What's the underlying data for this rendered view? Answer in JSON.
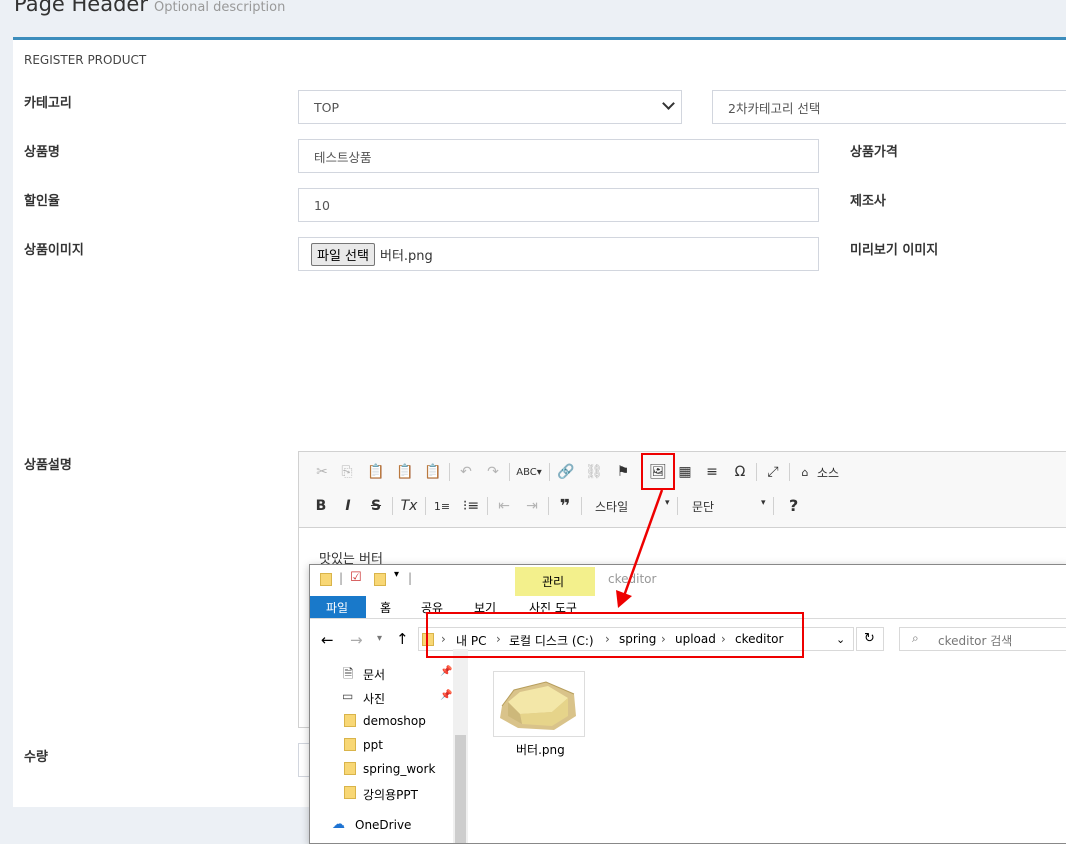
{
  "page_header": {
    "title": "Page Header",
    "description": "Optional description"
  },
  "box_title": "REGISTER PRODUCT",
  "form": {
    "category_label": "카테고리",
    "category_value": "TOP",
    "subcategory_value": "2차카테고리 선택",
    "name_label": "상품명",
    "name_value": "테스트상품",
    "price_label": "상품가격",
    "discount_label": "할인율",
    "discount_value": "10",
    "maker_label": "제조사",
    "image_label": "상품이미지",
    "file_button": "파일 선택",
    "file_name": "버터.png",
    "preview_label": "미리보기 이미지",
    "description_label": "상품설명",
    "quantity_label": "수량"
  },
  "editor": {
    "content": "맛있는 버터",
    "source_label": "소스",
    "style_label": "스타일",
    "paragraph_label": "문단",
    "help_label": "?"
  },
  "explorer": {
    "title": "ckeditor",
    "manage_tab": "관리",
    "ribbon_tabs": [
      "파일",
      "홈",
      "공유",
      "보기",
      "사진 도구"
    ],
    "path": [
      "내 PC",
      "로컬 디스크 (C:)",
      "spring",
      "upload",
      "ckeditor"
    ],
    "search_placeholder": "ckeditor 검색",
    "nav_items": [
      "문서",
      "사진",
      "demoshop",
      "ppt",
      "spring_work",
      "강의용PPT",
      "OneDrive"
    ],
    "file_name": "버터.png"
  },
  "colors": {
    "accent": "#3c8dbc",
    "highlight": "#ee0000",
    "ribbon_blue": "#1979ca",
    "manage_yellow": "#f3f08c"
  }
}
